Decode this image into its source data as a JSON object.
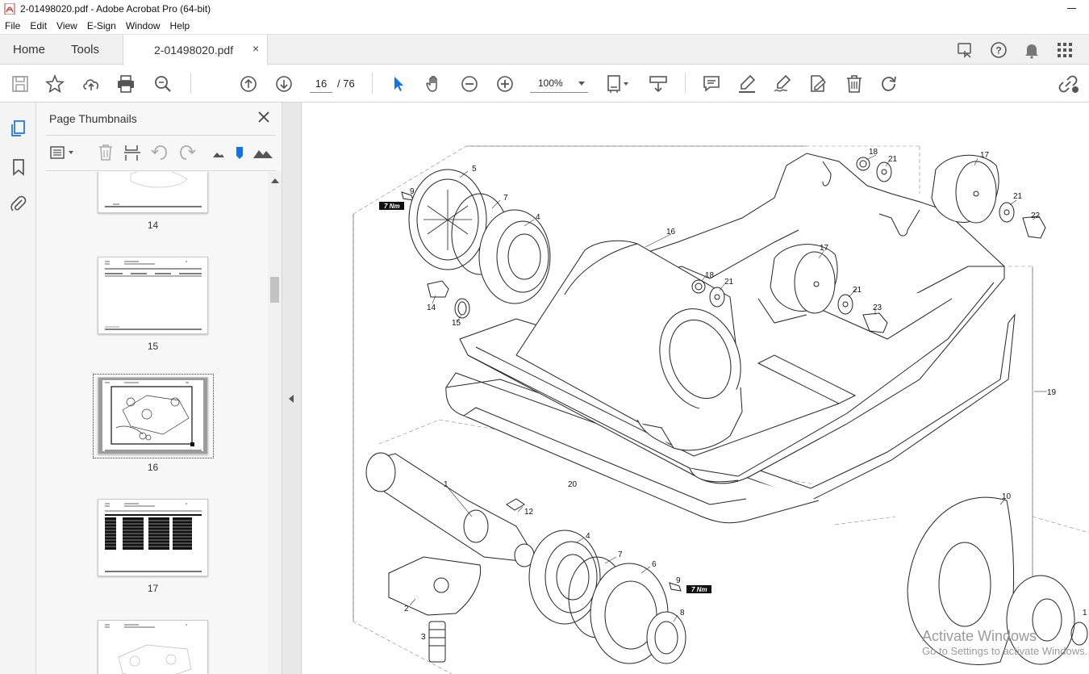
{
  "window": {
    "title": "2-01498020.pdf - Adobe Acrobat Pro (64-bit)"
  },
  "menu": [
    "File",
    "Edit",
    "View",
    "E-Sign",
    "Window",
    "Help"
  ],
  "tabs": {
    "home": "Home",
    "tools": "Tools",
    "document": "2-01498020.pdf",
    "close": "×"
  },
  "toolbar": {
    "current_page": "16",
    "total_pages": "/ 76",
    "zoom": "100%"
  },
  "panel": {
    "title": "Page Thumbnails",
    "thumbnails": [
      {
        "label": "14"
      },
      {
        "label": "15"
      },
      {
        "label": "16",
        "selected": true
      },
      {
        "label": "17"
      }
    ]
  },
  "drawing": {
    "callouts": [
      "1",
      "2",
      "3",
      "4",
      "4",
      "5",
      "6",
      "7",
      "7",
      "8",
      "9",
      "9",
      "10",
      "12",
      "14",
      "15",
      "16",
      "16",
      "17",
      "17",
      "18",
      "18",
      "19",
      "20",
      "21",
      "21",
      "21",
      "21",
      "22",
      "23"
    ],
    "torque_label": "7 Nm"
  },
  "watermark": {
    "line1": "Activate Windows",
    "line2": "Go to Settings to activate Windows."
  },
  "icons": [
    "save-icon",
    "star-icon",
    "cloud-upload-icon",
    "print-icon",
    "zoom-search-icon",
    "page-up-icon",
    "page-down-icon",
    "select-cursor-icon",
    "hand-icon",
    "zoom-out-icon",
    "zoom-in-icon",
    "page-fit-icon",
    "scroll-mode-icon",
    "comment-icon",
    "highlight-icon",
    "sign-icon",
    "fill-sign-icon",
    "delete-icon",
    "rotate-icon",
    "share-link-icon"
  ]
}
